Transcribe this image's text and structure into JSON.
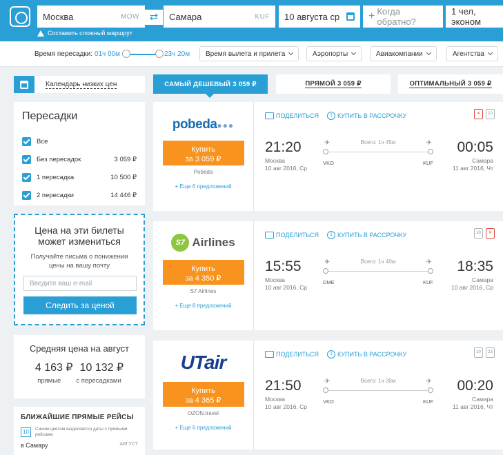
{
  "search": {
    "from_city": "Москва",
    "from_code": "MOW",
    "to_city": "Самара",
    "to_code": "KUF",
    "date": "10 августа ср",
    "return_placeholder": "Когда обратно?",
    "passengers": "1 чел, эконом",
    "complex_route": "Составить сложный маршрут"
  },
  "filters": {
    "transfer_time_label": "Время пересадки:",
    "transfer_from": "01ч 00м",
    "transfer_to": "23ч 20м",
    "dropdowns": [
      "Время вылета и прилета",
      "Аэропорты",
      "Авиакомпании",
      "Агентства"
    ]
  },
  "sidebar": {
    "calendar_link": "Календарь низких цен",
    "stops_title": "Пересадки",
    "stops": [
      {
        "label": "Все",
        "price": ""
      },
      {
        "label": "Без пересадок",
        "price": "3 059 ₽"
      },
      {
        "label": "1 пересадка",
        "price": "10 500 ₽"
      },
      {
        "label": "2 пересадки",
        "price": "14 446 ₽"
      }
    ],
    "alert_title": "Цена на эти билеты может измениться",
    "alert_text": "Получайте письма о понижении цены на вашу почту",
    "email_placeholder": "Введите ваш e-mail",
    "follow_button": "Следить за ценой",
    "avg_title": "Средняя цена на август",
    "avg_direct": "4 163 ₽",
    "avg_transfer": "10 132 ₽",
    "avg_direct_label": "прямые",
    "avg_transfer_label": "с пересадками",
    "nearest_title": "БЛИЖАЙШИЕ ПРЯМЫЕ РЕЙСЫ",
    "nearest_day": "10",
    "nearest_hint": "Синим цветом выделяются даты с прямыми рейсами",
    "nearest_city": "в Самару",
    "nearest_month": "АВГУСТ"
  },
  "tabs": [
    {
      "label": "САМЫЙ ДЕШЕВЫЙ 3 059 ₽"
    },
    {
      "label": "ПРЯМОЙ 3 059 ₽"
    },
    {
      "label": "ОПТИМАЛЬНЫЙ 3 059 ₽"
    }
  ],
  "tickets": [
    {
      "airline": "pobeda",
      "buy_line1": "Купить",
      "buy_line2": "за 3 059 ₽",
      "agent": "Pobeda",
      "more": "+ Еще 6 предложений",
      "share": "ПОДЕЛИТЬСЯ",
      "installment": "КУПИТЬ В РАССРОЧКУ",
      "dep_time": "21:20",
      "dep_city": "Москва",
      "dep_date": "10 авг 2016, Ср",
      "arr_time": "00:05",
      "arr_city": "Самара",
      "arr_date": "11 авг 2016, Чт",
      "total": "Всего: 1ч 45м",
      "dep_code": "VKO",
      "arr_code": "KUF"
    },
    {
      "airline": "Airlines",
      "airline_badge": "S7",
      "buy_line1": "Купить",
      "buy_line2": "за 4 350 ₽",
      "agent": "S7 Airlines",
      "more": "+ Еще 8 предложений",
      "share": "ПОДЕЛИТЬСЯ",
      "installment": "КУПИТЬ В РАССРОЧКУ",
      "dep_time": "15:55",
      "dep_city": "Москва",
      "dep_date": "10 авг 2016, Ср",
      "arr_time": "18:35",
      "arr_city": "Самара",
      "arr_date": "10 авг 2016, Ср",
      "total": "Всего: 1ч 40м",
      "dep_code": "DME",
      "arr_code": "KUF"
    },
    {
      "airline": "UTair",
      "buy_line1": "Купить",
      "buy_line2": "за 4 365 ₽",
      "agent": "OZON.travel",
      "more": "+ Еще 6 предложений",
      "share": "ПОДЕЛИТЬСЯ",
      "installment": "КУПИТЬ В РАССРОЧКУ",
      "dep_time": "21:50",
      "dep_city": "Москва",
      "dep_date": "10 авг 2016, Ср",
      "arr_time": "00:20",
      "arr_city": "Самара",
      "arr_date": "11 авг 2016, Чт",
      "total": "Всего: 1ч 30м",
      "dep_code": "VKO",
      "arr_code": "KUF"
    }
  ],
  "colors": {
    "brand_blue": "#2a9fd6",
    "buy_orange": "#f7931e"
  }
}
